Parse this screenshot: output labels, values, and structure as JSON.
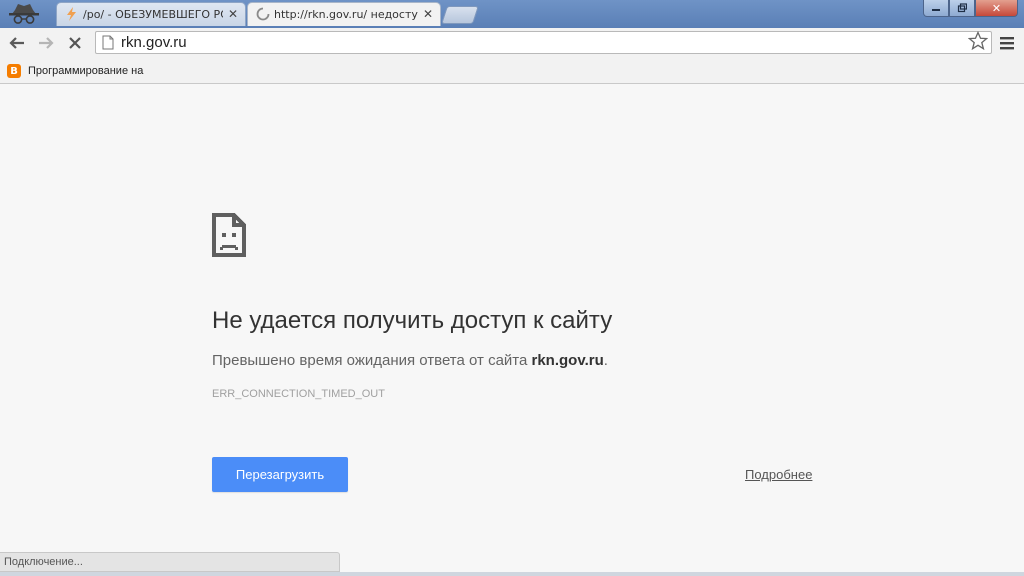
{
  "tabs": [
    {
      "title": "/po/ - ОБЕЗУМЕВШЕГО РОС",
      "active": false
    },
    {
      "title": "http://rkn.gov.ru/ недоступе",
      "active": true
    }
  ],
  "toolbar": {
    "url": "rkn.gov.ru"
  },
  "bookmarks": [
    {
      "label": "Программирование на",
      "icon": "blogger-icon"
    }
  ],
  "error": {
    "title": "Не удается получить доступ к сайту",
    "description_prefix": "Превышено время ожидания ответа от сайта ",
    "description_host": "rkn.gov.ru",
    "description_suffix": ".",
    "code": "ERR_CONNECTION_TIMED_OUT",
    "reload_label": "Перезагрузить",
    "details_label": "Подробнее"
  },
  "status_bar": {
    "text": "Подключение..."
  },
  "colors": {
    "accent_button": "#4b8df8",
    "frame": "#5a7fb6"
  }
}
